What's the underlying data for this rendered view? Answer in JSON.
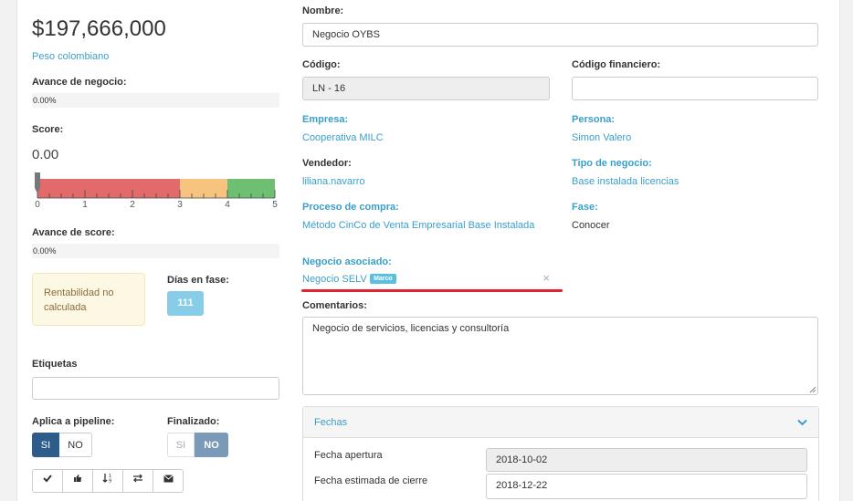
{
  "left": {
    "amount": "$197,666,000",
    "currency": "Peso colombiano",
    "avance_negocio_label": "Avance de negocio:",
    "avance_negocio_value": "0.00%",
    "avance_negocio_fraction": 0,
    "score_label": "Score:",
    "score_value": "0.00",
    "score_ticks": [
      "0",
      "1",
      "2",
      "3",
      "4",
      "5"
    ],
    "score_colors": {
      "red": "#e26a6a",
      "orange": "#f7c47f",
      "green": "#6fbf73"
    },
    "avance_score_label": "Avance de score:",
    "avance_score_value": "0.00%",
    "avance_score_fraction": 0,
    "rentabilidad_text": "Rentabilidad no calculada",
    "dias_label": "Días en fase:",
    "dias_value": "111",
    "etiquetas_label": "Etiquetas",
    "etiquetas_value": "",
    "pipeline_label": "Aplica a pipeline:",
    "pipeline_si": "SI",
    "pipeline_no": "NO",
    "finalizado_label": "Finalizado:",
    "finalizado_si": "SI",
    "finalizado_no": "NO",
    "action_icons": [
      "check-icon",
      "thumbs-up-icon",
      "sort-icon",
      "exchange-icon",
      "envelope-icon"
    ]
  },
  "form": {
    "nombre_label": "Nombre:",
    "nombre_value": "Negocio OYBS",
    "codigo_label": "Código:",
    "codigo_value": "LN - 16",
    "codigo_fin_label": "Código financiero:",
    "codigo_fin_value": "",
    "empresa_label": "Empresa:",
    "empresa_value": "Cooperativa MILC",
    "persona_label": "Persona:",
    "persona_value": "Simon Valero",
    "vendedor_label": "Vendedor:",
    "vendedor_value": "liliana.navarro",
    "tipo_label": "Tipo de negocio:",
    "tipo_value": "Base instalada licencias",
    "proceso_label": "Proceso de compra:",
    "proceso_value": "Método CinCo de Venta Empresarial Base Instalada",
    "fase_label": "Fase:",
    "fase_value": "Conocer",
    "asociado_label": "Negocio asociado:",
    "asociado_value": "Negocio SELV",
    "asociado_tag": "Marco",
    "asociado_close": "×",
    "comentarios_label": "Comentarios:",
    "comentarios_value": "Negocio de servicios, licencias y consultoría"
  },
  "fechas": {
    "title": "Fechas",
    "apertura_label": "Fecha apertura",
    "apertura_value": "2018-10-02",
    "cierre_label": "Fecha estimada de cierre",
    "cierre_value": "2018-12-22"
  },
  "colors": {
    "link_blue": "#3a9fc9",
    "toggle_active": "#2c5d8a",
    "toggle_active_light": "#7a9ab7",
    "underline_red": "#e0232e"
  }
}
